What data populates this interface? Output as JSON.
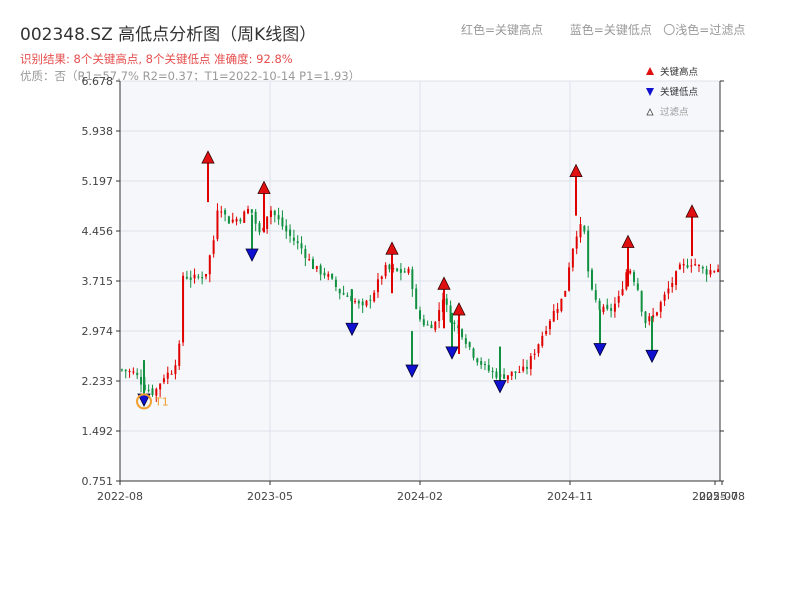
{
  "title": "002348.SZ 高低点分析图（周K线图）",
  "subtitle": "识别结果: 8个关键高点, 8个关键低点   准确度: 92.8%",
  "subtitle2": "优质：否（R1=57.7%  R2=0.37；T1=2022-10-14 P1=1.93）",
  "top_legend": {
    "red": "红色=关键高点",
    "blue": "蓝色=关键低点",
    "light": "〇浅色=过滤点"
  },
  "colors": {
    "up": "#e00000",
    "down": "#109040",
    "high_marker": "#e01010",
    "low_marker": "#1010d0",
    "t1_ring": "#f0a030",
    "plot_bg": "#f5f7fa",
    "grid": "#dde2ea"
  },
  "chart_data": {
    "type": "candlestick",
    "title": "002348.SZ 高低点分析图（周K线图）",
    "y_ticks": [
      "6.678",
      "5.938",
      "5.197",
      "4.456",
      "3.715",
      "2.974",
      "2.233",
      "1.492",
      "0.751"
    ],
    "ylim": [
      0.751,
      6.678
    ],
    "x_ticks": [
      "2022-08",
      "2023-05",
      "2024-02",
      "2024-11",
      "2025-07",
      "2025-08"
    ],
    "legend": [
      "关键高点",
      "关键低点",
      "过滤点"
    ],
    "key_highs": [
      5.55,
      5.1,
      4.2,
      3.68,
      3.3,
      5.35,
      4.3,
      4.75
    ],
    "key_lows": [
      1.95,
      4.1,
      3.0,
      2.38,
      2.65,
      2.15,
      2.7,
      2.6
    ],
    "t1_label": "T1",
    "t1_value": 1.93,
    "weeks": 157,
    "close_path": [
      [
        0,
        2.4
      ],
      [
        4,
        2.35
      ],
      [
        7,
        2.15
      ],
      [
        10,
        2.05
      ],
      [
        13,
        2.3
      ],
      [
        16,
        2.4
      ],
      [
        18,
        2.75
      ],
      [
        19,
        3.8
      ],
      [
        22,
        3.75
      ],
      [
        26,
        3.8
      ],
      [
        29,
        4.4
      ],
      [
        30,
        4.9
      ],
      [
        33,
        4.6
      ],
      [
        37,
        4.65
      ],
      [
        40,
        4.8
      ],
      [
        43,
        4.4
      ],
      [
        46,
        4.8
      ],
      [
        49,
        4.6
      ],
      [
        52,
        4.4
      ],
      [
        56,
        4.2
      ],
      [
        60,
        3.9
      ],
      [
        64,
        3.8
      ],
      [
        68,
        3.55
      ],
      [
        72,
        3.45
      ],
      [
        75,
        3.3
      ],
      [
        78,
        3.5
      ],
      [
        82,
        3.9
      ],
      [
        86,
        3.85
      ],
      [
        90,
        3.85
      ],
      [
        92,
        3.2
      ],
      [
        95,
        3.05
      ],
      [
        98,
        3.1
      ],
      [
        100,
        3.5
      ],
      [
        103,
        3.1
      ],
      [
        106,
        2.95
      ],
      [
        110,
        2.6
      ],
      [
        114,
        2.4
      ],
      [
        118,
        2.3
      ],
      [
        122,
        2.35
      ],
      [
        126,
        2.4
      ],
      [
        130,
        2.8
      ],
      [
        134,
        3.2
      ],
      [
        138,
        3.5
      ],
      [
        140,
        4.1
      ],
      [
        142,
        4.45
      ],
      [
        144,
        4.55
      ],
      [
        146,
        3.6
      ],
      [
        149,
        3.3
      ],
      [
        152,
        3.25
      ],
      [
        155,
        3.45
      ],
      [
        158,
        3.95
      ],
      [
        161,
        3.6
      ],
      [
        163,
        3.1
      ],
      [
        166,
        3.2
      ],
      [
        170,
        3.55
      ],
      [
        174,
        3.9
      ],
      [
        178,
        4.0
      ],
      [
        182,
        3.85
      ],
      [
        186,
        3.9
      ]
    ]
  }
}
